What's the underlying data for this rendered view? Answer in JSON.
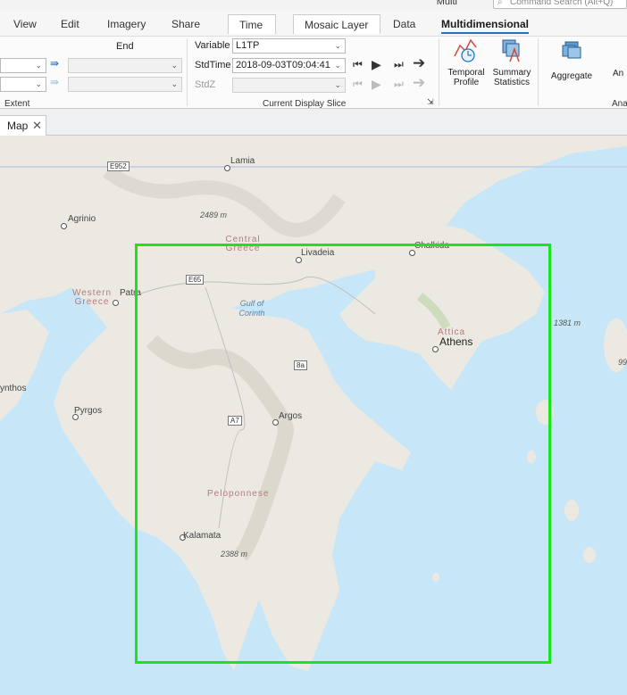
{
  "titlebar": {
    "mode_text": "Multi",
    "search_placeholder": "Command Search (Alt+Q)"
  },
  "tabs": [
    {
      "label": "View"
    },
    {
      "label": "Edit"
    },
    {
      "label": "Imagery"
    },
    {
      "label": "Share"
    },
    {
      "label": "Time"
    },
    {
      "label": "Mosaic Layer"
    },
    {
      "label": "Data"
    },
    {
      "label": "Multidimensional"
    }
  ],
  "ribbon": {
    "end_label": "End",
    "extent_group_label": "Extent",
    "variable_label": "Variable",
    "variable_value": "L1TP",
    "stdtime_label": "StdTime",
    "stdtime_value": "2018-09-03T09:04:41",
    "stdz_label": "StdZ",
    "stdz_value": "",
    "current_slice_group_label": "Current Display Slice",
    "temporal_profile_label": "Temporal Profile",
    "summary_statistics_label": "Summary Statistics",
    "aggregate_label": "Aggregate",
    "analysis_partial": "Ana",
    "cut_button_partial": "An"
  },
  "map_tab": {
    "label": "Map",
    "close": "✕"
  },
  "map": {
    "places": {
      "lamia": "Lamia",
      "agrinio": "Agrinio",
      "central_greece": "Central Greece",
      "livadeia": "Livadeia",
      "chalkida": "Chalkida",
      "western_greece": "Western Greece",
      "patra": "Patra",
      "gulf_of_corinth": "Gulf of Corinth",
      "attica": "Attica",
      "athens": "Athens",
      "zakynthos": "ynthos",
      "pyrgos": "Pyrgos",
      "argos": "Argos",
      "peloponnese": "Peloponnese",
      "kalamata": "Kalamata"
    },
    "elevations": {
      "e2489": "2489 m",
      "e1381": "1381 m",
      "e2388": "2388 m",
      "e99": "99"
    },
    "roads": {
      "e952": "E952",
      "e65": "E65",
      "r8a": "8a",
      "a7": "A7"
    }
  },
  "colors": {
    "extent_box": "#19e619",
    "water": "#c7e6f7",
    "land": "#ece9e2",
    "active_tab": "#1f73c9"
  }
}
